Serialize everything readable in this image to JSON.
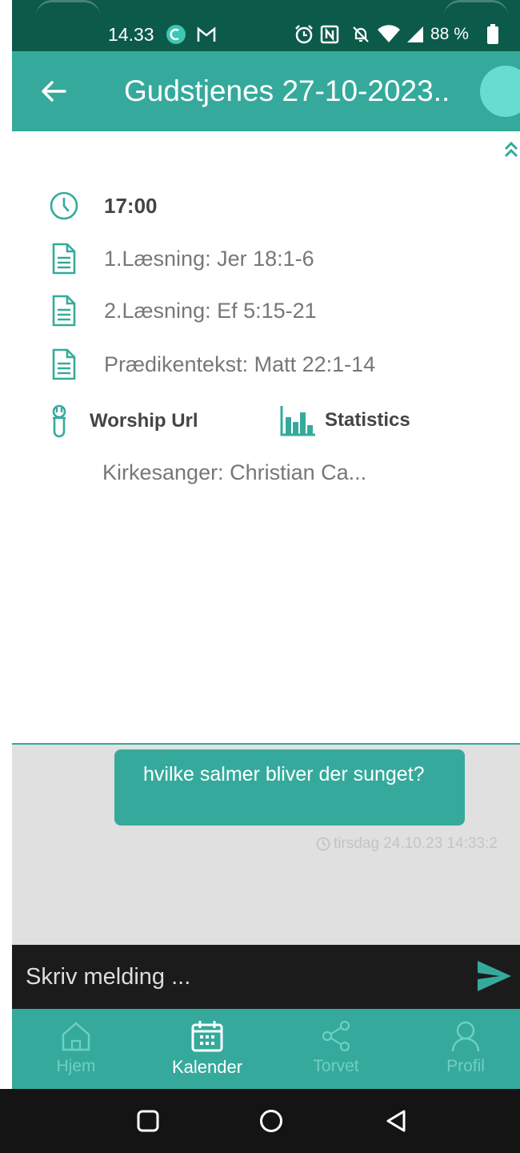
{
  "status_bar": {
    "time": "14.33",
    "battery": "88 %",
    "icons": [
      "chat-bubble-icon",
      "gmail-icon",
      "alarm-icon",
      "nfc-icon",
      "mute-icon",
      "wifi-icon",
      "signal-icon",
      "battery-icon"
    ]
  },
  "app_bar": {
    "title": "Gudstjenes 27-10-2023.."
  },
  "details": {
    "time": "17:00",
    "reading1": "1.Læsning: Jer 18:1-6",
    "reading2": "2.Læsning: Ef 5:15-21",
    "sermon_text": "Prædikentekst: Matt 22:1-14",
    "worship_url_label": "Worship Url",
    "statistics_label": "Statistics",
    "singer": "Kirkesanger: Christian Ca..."
  },
  "chat": {
    "message": "hvilke salmer bliver der sunget?",
    "message_time": "tirsdag 24.10.23 14:33:2",
    "input_placeholder": "Skriv melding ..."
  },
  "bottom_nav": {
    "items": [
      {
        "label": "Hjem",
        "icon": "home-icon"
      },
      {
        "label": "Kalender",
        "icon": "calendar-icon",
        "active": true
      },
      {
        "label": "Torvet",
        "icon": "share-icon"
      },
      {
        "label": "Profil",
        "icon": "profile-icon"
      }
    ]
  },
  "colors": {
    "primary": "#35aa9c",
    "status_bar": "#0c5a4a",
    "chat_bg": "#e0e0e0",
    "input_bg": "#1b1b1b"
  }
}
